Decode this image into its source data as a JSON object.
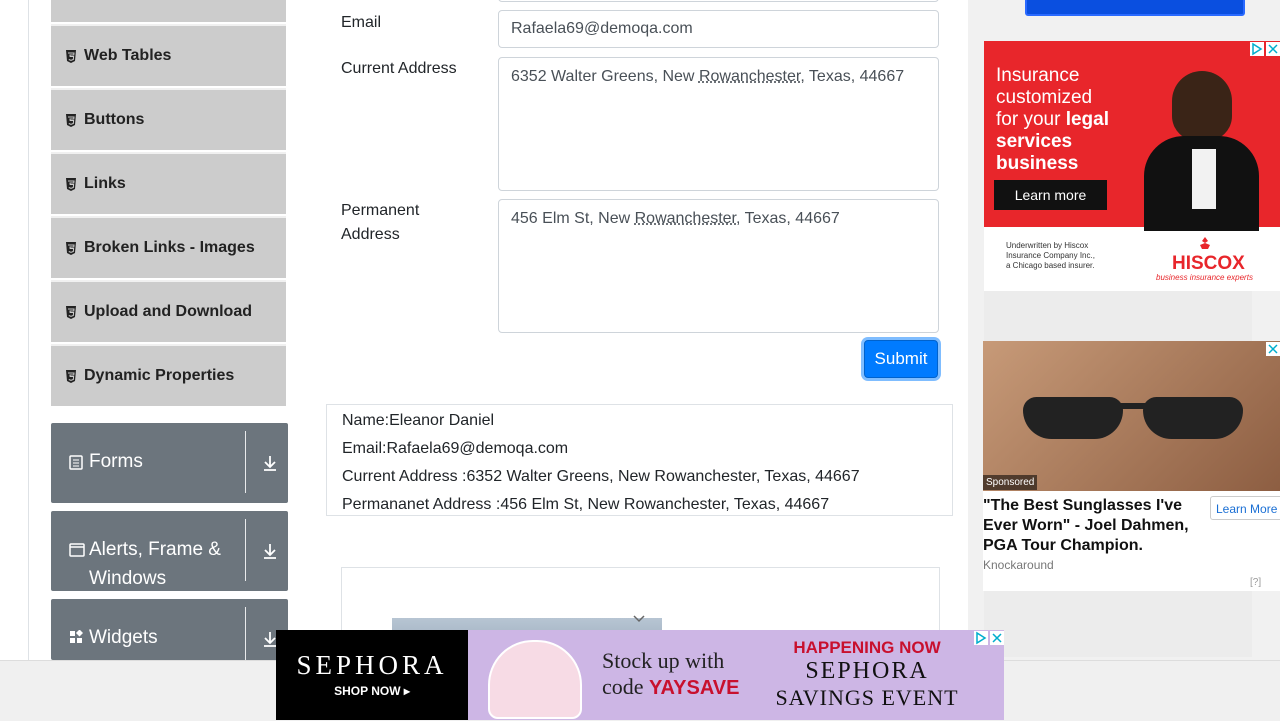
{
  "sidebar": {
    "items": [
      {
        "label": "Web Tables"
      },
      {
        "label": "Buttons"
      },
      {
        "label": "Links"
      },
      {
        "label": "Broken Links - Images"
      },
      {
        "label": "Upload and Download"
      },
      {
        "label": "Dynamic Properties"
      }
    ],
    "groups": [
      {
        "label": "Forms"
      },
      {
        "label": "Alerts, Frame & Windows"
      },
      {
        "label": "Widgets"
      }
    ]
  },
  "form": {
    "email_label": "Email",
    "email_value": "Rafaela69@demoqa.com",
    "current_address_label": "Current Address",
    "current_address_pre": "6352 Walter Greens, New ",
    "current_address_mark": "Rowanchester",
    "current_address_post": ", Texas, 44667",
    "permanent_address_label_1": "Permanent",
    "permanent_address_label_2": "Address",
    "permanent_address_pre": "456 Elm St, New ",
    "permanent_address_mark": "Rowanchester",
    "permanent_address_post": ", Texas, 44667",
    "submit_label": "Submit"
  },
  "output": {
    "name": "Name:Eleanor Daniel",
    "email": "Email:Rafaela69@demoqa.com",
    "current_address": "Current Address :6352 Walter Greens, New Rowanchester, Texas, 44667",
    "permanent_address": "Permananet Address :456 Elm St, New Rowanchester, Texas, 44667"
  },
  "ads": {
    "hiscox": {
      "line1": "Insurance",
      "line2": "customized",
      "line3_pre": "for your ",
      "line3_em": "legal",
      "line4": "services",
      "line5": "business",
      "cta": "Learn more",
      "small1": "Underwritten by Hiscox",
      "small2": "Insurance Company Inc.,",
      "small3": "a Chicago based insurer.",
      "brand": "HISCOX",
      "tagline": "business insurance experts"
    },
    "sunglasses": {
      "sponsored": "Sponsored",
      "headline": "\"The Best Sunglasses I've Ever Worn\" - Joel Dahmen, PGA Tour Champion.",
      "source": "Knockaround",
      "cta": "Learn More",
      "help": "[?]"
    },
    "sephora": {
      "brand": "SEPHORA",
      "shop_now": "SHOP NOW",
      "stock_line1": "Stock up with",
      "stock_code_pre": "code ",
      "stock_code": "YAYSAVE",
      "happening": "HAPPENING NOW",
      "event_brand": "SEPHORA",
      "event": "SAVINGS EVENT"
    }
  },
  "colors": {
    "accent": "#007bff",
    "sidebar_item_bg": "#cccccc",
    "group_bg": "#6c757d",
    "hiscox_red": "#e8262b",
    "sephora_lavender": "#cdb6e5"
  }
}
